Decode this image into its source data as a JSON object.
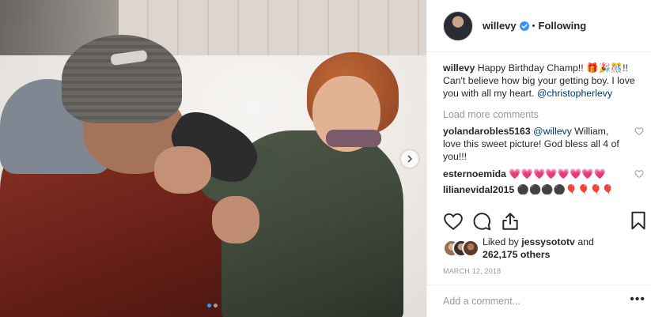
{
  "post": {
    "username": "willevy",
    "follow_status": "Following",
    "separator": "•",
    "caption": {
      "username": "willevy",
      "text": "Happy Birthday Champ!! 🎁🎉🎊!! Can't believe how big your getting boy. I love you with all my heart.",
      "mention": "@christopherlevy"
    },
    "load_more_label": "Load more comments",
    "comments": [
      {
        "username": "yolandarobles5163",
        "mention": "@willevy",
        "text": "William, love this sweet picture! God bless all 4 of you!!!"
      },
      {
        "username": "esternoemida",
        "mention": "",
        "text": "💗💗💗💗💗💗💗💗"
      },
      {
        "username": "lilianevidal2015",
        "mention": "",
        "text": "⚫⚫⚫⚫🎈🎈🎈🎈✝✝✝✝"
      }
    ],
    "likes": {
      "prefix": "Liked by",
      "user": "jessysototv",
      "conjunction": "and",
      "count": "262,175 others"
    },
    "date": "MARCH 12, 2018",
    "add_comment_placeholder": "Add a comment...",
    "more_options": "•••",
    "carousel": {
      "total": 2,
      "active": 0
    }
  },
  "icons": {
    "verified": "verified-badge-icon",
    "like": "heart-icon",
    "comment": "comment-icon",
    "share": "share-icon",
    "save": "bookmark-icon",
    "next": "chevron-right-icon"
  },
  "colors": {
    "link": "#003569",
    "verified": "#3897f0",
    "muted": "#999999",
    "text": "#262626"
  }
}
